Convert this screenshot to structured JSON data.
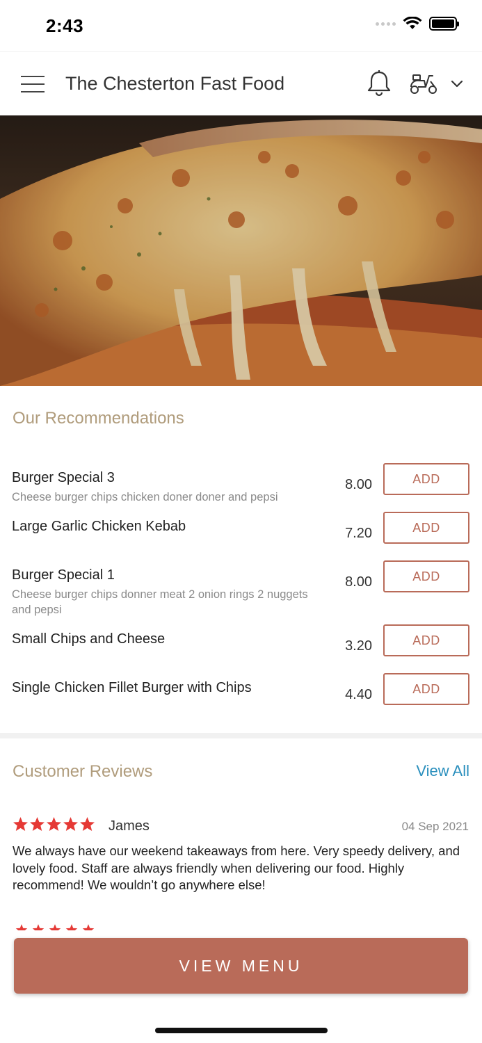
{
  "status_bar": {
    "time": "2:43"
  },
  "header": {
    "title": "The Chesterton Fast Food"
  },
  "recommendations": {
    "title": "Our Recommendations",
    "items": [
      {
        "name": "Burger Special 3",
        "description": "Cheese burger chips chicken doner doner and pepsi",
        "price": "8.00",
        "add_label": "ADD"
      },
      {
        "name": "Large Garlic Chicken Kebab",
        "description": "",
        "price": "7.20",
        "add_label": "ADD"
      },
      {
        "name": "Burger Special 1",
        "description": "Cheese burger chips donner meat 2 onion rings 2 nuggets and pepsi",
        "price": "8.00",
        "add_label": "ADD"
      },
      {
        "name": "Small Chips and Cheese",
        "description": "",
        "price": "3.20",
        "add_label": "ADD"
      },
      {
        "name": "Single Chicken Fillet Burger with Chips",
        "description": "",
        "price": "4.40",
        "add_label": "ADD"
      }
    ]
  },
  "reviews": {
    "title": "Customer Reviews",
    "view_all_label": "View All",
    "items": [
      {
        "rating": 5,
        "reviewer": "James",
        "date": "04 Sep 2021",
        "text": "We always have our weekend takeaways from here. Very speedy delivery, and lovely food. Staff are always friendly when delivering our food. Highly recommend! We wouldn’t go anywhere else!"
      }
    ]
  },
  "cta": {
    "label": "VIEW MENU"
  },
  "colors": {
    "accent": "#b96b59",
    "section_title": "#b09c7c",
    "link": "#2a8fbd",
    "star": "#e53935"
  },
  "icons": {
    "menu": "hamburger-icon",
    "notifications": "bell-icon",
    "delivery": "scooter-icon",
    "dropdown": "chevron-down-icon",
    "rating": "star-icon"
  }
}
